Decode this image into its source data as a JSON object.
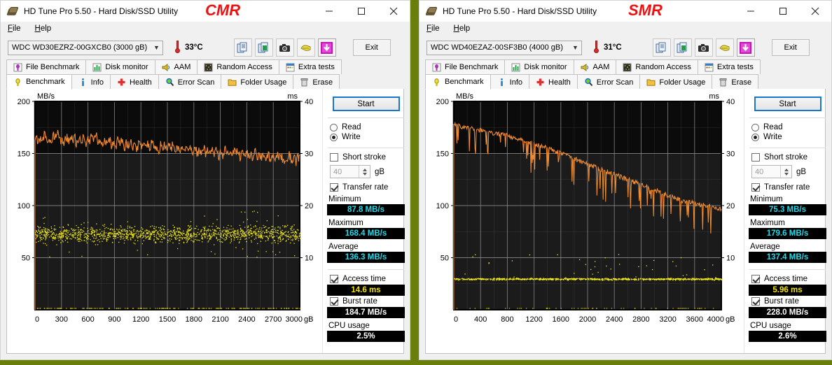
{
  "windows": [
    {
      "id": "cmr",
      "title": "HD Tune Pro 5.50 - Hard Disk/SSD Utility",
      "overlay_tag": "CMR",
      "overlay_color": "#ee1111",
      "menu": [
        {
          "label": "File"
        },
        {
          "label": "Help"
        }
      ],
      "toolbar": {
        "drive": "WDC WD30EZRZ-00GXCB0 (3000 gB)",
        "temperature": "33°C",
        "icons": [
          "copy-text-icon",
          "copy-excel-icon",
          "screenshot-icon",
          "save-icon",
          "download-icon"
        ],
        "exit_label": "Exit"
      },
      "tabs_row1": [
        {
          "label": "File Benchmark",
          "icon": "file-benchmark-icon",
          "active": false
        },
        {
          "label": "Disk monitor",
          "icon": "disk-monitor-icon",
          "active": false
        },
        {
          "label": "AAM",
          "icon": "aam-speaker-icon",
          "active": false
        },
        {
          "label": "Random Access",
          "icon": "random-access-icon",
          "active": false
        },
        {
          "label": "Extra tests",
          "icon": "extra-tests-icon",
          "active": false
        }
      ],
      "tabs_row2": [
        {
          "label": "Benchmark",
          "icon": "benchmark-bulb-icon",
          "active": true
        },
        {
          "label": "Info",
          "icon": "info-icon",
          "active": false
        },
        {
          "label": "Health",
          "icon": "health-cross-icon",
          "active": false
        },
        {
          "label": "Error Scan",
          "icon": "error-scan-magnifier-icon",
          "active": false
        },
        {
          "label": "Folder Usage",
          "icon": "folder-usage-icon",
          "active": false
        },
        {
          "label": "Erase",
          "icon": "erase-trash-icon",
          "active": false
        }
      ],
      "panel": {
        "start_label": "Start",
        "mode_read": "Read",
        "mode_write": "Write",
        "mode_selected": "Write",
        "short_stroke_label": "Short stroke",
        "short_stroke_checked": false,
        "short_stroke_value": "40",
        "short_stroke_unit": "gB",
        "transfer_rate_label": "Transfer rate",
        "transfer_rate_checked": true,
        "minimum_label": "Minimum",
        "minimum_value": "87.8 MB/s",
        "maximum_label": "Maximum",
        "maximum_value": "168.4 MB/s",
        "average_label": "Average",
        "average_value": "136.3 MB/s",
        "access_time_label": "Access time",
        "access_time_checked": true,
        "access_time_value": "14.6 ms",
        "burst_rate_label": "Burst rate",
        "burst_rate_checked": true,
        "burst_rate_value": "184.7 MB/s",
        "cpu_usage_label": "CPU usage",
        "cpu_usage_value": "2.5%"
      }
    },
    {
      "id": "smr",
      "title": "HD Tune Pro 5.50 - Hard Disk/SSD Utility",
      "overlay_tag": "SMR",
      "overlay_color": "#ee1111",
      "menu": [
        {
          "label": "File"
        },
        {
          "label": "Help"
        }
      ],
      "toolbar": {
        "drive": "WDC WD40EZAZ-00SF3B0 (4000 gB)",
        "temperature": "31°C",
        "icons": [
          "copy-text-icon",
          "copy-excel-icon",
          "screenshot-icon",
          "save-icon",
          "download-icon"
        ],
        "exit_label": "Exit"
      },
      "tabs_row1": [
        {
          "label": "File Benchmark",
          "icon": "file-benchmark-icon",
          "active": false
        },
        {
          "label": "Disk monitor",
          "icon": "disk-monitor-icon",
          "active": false
        },
        {
          "label": "AAM",
          "icon": "aam-speaker-icon",
          "active": false
        },
        {
          "label": "Random Access",
          "icon": "random-access-icon",
          "active": false
        },
        {
          "label": "Extra tests",
          "icon": "extra-tests-icon",
          "active": false
        }
      ],
      "tabs_row2": [
        {
          "label": "Benchmark",
          "icon": "benchmark-bulb-icon",
          "active": true
        },
        {
          "label": "Info",
          "icon": "info-icon",
          "active": false
        },
        {
          "label": "Health",
          "icon": "health-cross-icon",
          "active": false
        },
        {
          "label": "Error Scan",
          "icon": "error-scan-magnifier-icon",
          "active": false
        },
        {
          "label": "Folder Usage",
          "icon": "folder-usage-icon",
          "active": false
        },
        {
          "label": "Erase",
          "icon": "erase-trash-icon",
          "active": false
        }
      ],
      "panel": {
        "start_label": "Start",
        "mode_read": "Read",
        "mode_write": "Write",
        "mode_selected": "Write",
        "short_stroke_label": "Short stroke",
        "short_stroke_checked": false,
        "short_stroke_value": "40",
        "short_stroke_unit": "gB",
        "transfer_rate_label": "Transfer rate",
        "transfer_rate_checked": true,
        "minimum_label": "Minimum",
        "minimum_value": "75.3 MB/s",
        "maximum_label": "Maximum",
        "maximum_value": "179.6 MB/s",
        "average_label": "Average",
        "average_value": "137.4 MB/s",
        "access_time_label": "Access time",
        "access_time_checked": true,
        "access_time_value": "5.96 ms",
        "burst_rate_label": "Burst rate",
        "burst_rate_checked": true,
        "burst_rate_value": "228.0 MB/s",
        "cpu_usage_label": "CPU usage",
        "cpu_usage_value": "2.6%"
      }
    }
  ],
  "chart_data": [
    {
      "id": "cmr-benchmark-chart",
      "type": "line",
      "title": "",
      "ylabel": "MB/s",
      "y2label": "ms",
      "xlabel": "gB",
      "xlim": [
        0,
        3000
      ],
      "ylim": [
        0,
        200
      ],
      "y2lim": [
        0,
        40
      ],
      "xticks": [
        0,
        300,
        600,
        900,
        1200,
        1500,
        1800,
        2100,
        2400,
        2700,
        3000
      ],
      "yticks": [
        50,
        100,
        150,
        200
      ],
      "y2ticks": [
        10,
        20,
        30,
        40
      ],
      "grid": true,
      "legend": "none",
      "series": [
        {
          "name": "Transfer rate",
          "color": "#ef8a30",
          "units": "MB/s",
          "x": [
            0,
            60,
            120,
            180,
            240,
            300,
            360,
            420,
            480,
            540,
            600,
            660,
            720,
            780,
            840,
            900,
            960,
            1020,
            1080,
            1140,
            1200,
            1260,
            1320,
            1380,
            1440,
            1500,
            1560,
            1620,
            1680,
            1740,
            1800,
            1860,
            1920,
            1980,
            2040,
            2100,
            2160,
            2220,
            2280,
            2340,
            2400,
            2460,
            2520,
            2580,
            2640,
            2700,
            2760,
            2820,
            2880,
            2940,
            3000
          ],
          "values": [
            165,
            163,
            166,
            162,
            168,
            161,
            164,
            166,
            160,
            163,
            161,
            167,
            164,
            158,
            162,
            159,
            161,
            158,
            160,
            157,
            159,
            156,
            160,
            154,
            157,
            155,
            158,
            153,
            155,
            152,
            154,
            151,
            153,
            150,
            152,
            149,
            151,
            150,
            152,
            148,
            150,
            147,
            149,
            146,
            148,
            145,
            147,
            144,
            146,
            143,
            145
          ]
        },
        {
          "name": "Access time",
          "color": "#f2eb16",
          "units": "ms",
          "mean": 14.6,
          "spread": 2.6,
          "style": "scatter-band"
        }
      ]
    },
    {
      "id": "smr-benchmark-chart",
      "type": "line",
      "title": "",
      "ylabel": "MB/s",
      "y2label": "ms",
      "xlabel": "gB",
      "xlim": [
        0,
        4000
      ],
      "ylim": [
        0,
        200
      ],
      "y2lim": [
        0,
        40
      ],
      "xticks": [
        0,
        400,
        800,
        1200,
        1600,
        2000,
        2400,
        2800,
        3200,
        3600,
        4000
      ],
      "yticks": [
        50,
        100,
        150,
        200
      ],
      "y2ticks": [
        10,
        20,
        30,
        40
      ],
      "grid": true,
      "legend": "none",
      "series": [
        {
          "name": "Transfer rate",
          "color": "#ef8a30",
          "units": "MB/s",
          "x": [
            0,
            80,
            160,
            240,
            320,
            400,
            480,
            560,
            640,
            720,
            800,
            880,
            960,
            1040,
            1120,
            1200,
            1280,
            1360,
            1440,
            1520,
            1600,
            1680,
            1760,
            1840,
            1920,
            2000,
            2080,
            2160,
            2240,
            2320,
            2400,
            2480,
            2560,
            2640,
            2720,
            2800,
            2880,
            2960,
            3040,
            3120,
            3200,
            3280,
            3360,
            3440,
            3520,
            3600,
            3680,
            3760,
            3840,
            3920,
            4000
          ],
          "values": [
            179,
            176,
            175,
            174,
            173,
            172,
            171,
            170,
            169,
            168,
            167,
            165,
            164,
            162,
            161,
            159,
            158,
            156,
            154,
            152,
            150,
            148,
            146,
            144,
            142,
            140,
            138,
            136,
            134,
            132,
            130,
            128,
            126,
            124,
            122,
            120,
            118,
            116,
            114,
            112,
            110,
            108,
            106,
            104,
            103,
            102,
            101,
            100,
            99,
            98,
            97
          ]
        },
        {
          "name": "Access time",
          "color": "#f2eb16",
          "units": "ms",
          "mean": 5.96,
          "spread": 0.5,
          "style": "scatter-band"
        }
      ]
    }
  ]
}
